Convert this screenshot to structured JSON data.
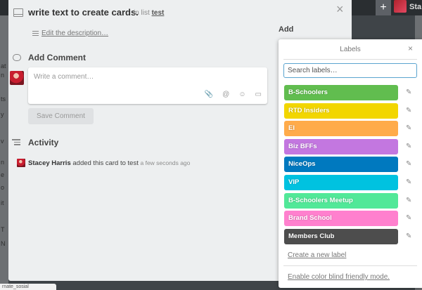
{
  "background": {
    "plus_glyph": "+",
    "user_partial": "Sta",
    "left_edge_lines": [
      "at",
      "n",
      "ts",
      "y",
      "v",
      "n",
      "e",
      "o",
      "it",
      "T",
      "N"
    ],
    "status_text": "rnate_sosial"
  },
  "card": {
    "title": "write text to create cards.",
    "in_list_prefix": "in list",
    "list_name": "test",
    "close_glyph": "×",
    "edit_description": "Edit the description…",
    "add_heading": "Add",
    "add_comment_title": "Add Comment",
    "comment_placeholder": "Write a comment…",
    "comment_tools": {
      "attach": "📎",
      "mention": "@",
      "emoji": "☺",
      "card": "▭"
    },
    "save_comment": "Save Comment",
    "activity_title": "Activity",
    "activity": {
      "user": "Stacey Harris",
      "action": "added this card to test",
      "time": "a few seconds ago"
    }
  },
  "labels_popover": {
    "title": "Labels",
    "close_glyph": "×",
    "search_placeholder": "Search labels…",
    "edit_glyph": "✎",
    "labels": [
      {
        "name": "B-Schoolers",
        "color": "#61bd4f"
      },
      {
        "name": "RTD Insiders",
        "color": "#f2d600"
      },
      {
        "name": "EI",
        "color": "#ffab4a"
      },
      {
        "name": "Biz BFFs",
        "color": "#c377e0"
      },
      {
        "name": "NiceOps",
        "color": "#0079bf"
      },
      {
        "name": "VIP",
        "color": "#00c2e0"
      },
      {
        "name": "B-Schoolers Meetup",
        "color": "#51e898"
      },
      {
        "name": "Brand School",
        "color": "#ff80ce"
      },
      {
        "name": "Members Club",
        "color": "#4d4d4d"
      }
    ],
    "create_label": "Create a new label",
    "color_blind": "Enable color blind friendly mode."
  }
}
